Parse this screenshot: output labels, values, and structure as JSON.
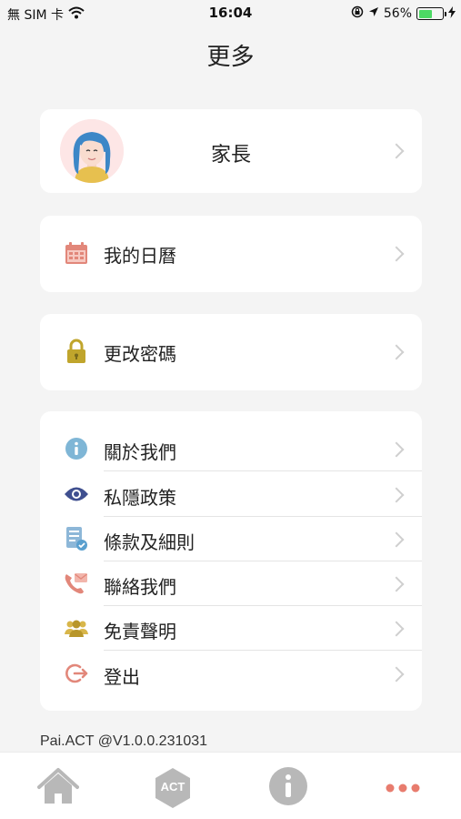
{
  "status_bar": {
    "carrier": "無 SIM 卡",
    "time": "16:04",
    "battery": "56%",
    "battery_level": 0.56
  },
  "header": {
    "title": "更多"
  },
  "profile": {
    "name": "家長"
  },
  "menu": {
    "calendar": "我的日曆",
    "change_password": "更改密碼"
  },
  "list": [
    {
      "label": "關於我們",
      "icon": "info-icon"
    },
    {
      "label": "私隱政策",
      "icon": "eye-icon"
    },
    {
      "label": "條款及細則",
      "icon": "document-icon"
    },
    {
      "label": "聯絡我們",
      "icon": "phone-mail-icon"
    },
    {
      "label": "免責聲明",
      "icon": "people-icon"
    },
    {
      "label": "登出",
      "icon": "logout-icon"
    }
  ],
  "footer": {
    "version": "Pai.ACT @V1.0.0.231031"
  },
  "tab_bar": {
    "act_label": "ACT",
    "active_color": "#e87c6e",
    "inactive_color": "#b8b8b8"
  }
}
